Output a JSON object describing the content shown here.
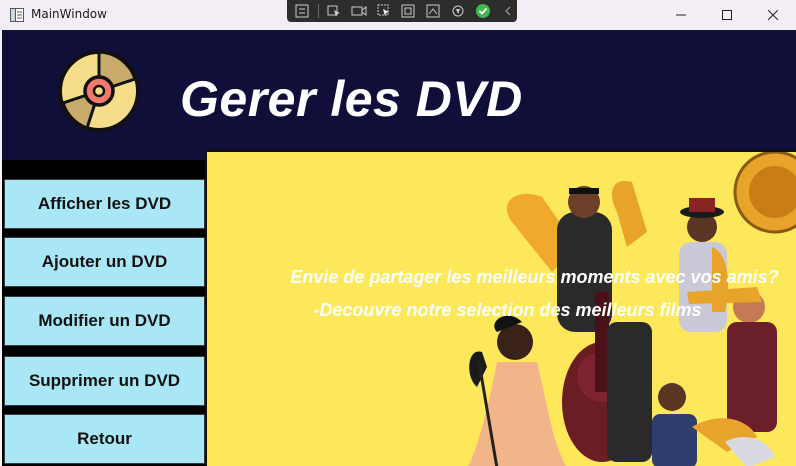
{
  "window": {
    "title": "MainWindow"
  },
  "header": {
    "title": "Gerer les DVD",
    "logo_icon": "dvd-disc-icon"
  },
  "sidebar": {
    "items": [
      {
        "label": "Afficher les DVD"
      },
      {
        "label": "Ajouter un DVD"
      },
      {
        "label": "Modifier un DVD"
      },
      {
        "label": "Supprimer un DVD"
      },
      {
        "label": "Retour"
      }
    ]
  },
  "banner": {
    "line1": "Envie de partager les meilleurs moments avec vos amis?",
    "line2": "-Decouvre notre selection des meilleurs films"
  },
  "colors": {
    "header_bg": "#0f0f3a",
    "panel_bg": "#fce85a",
    "nav_button_bg": "#a9e7f6"
  }
}
